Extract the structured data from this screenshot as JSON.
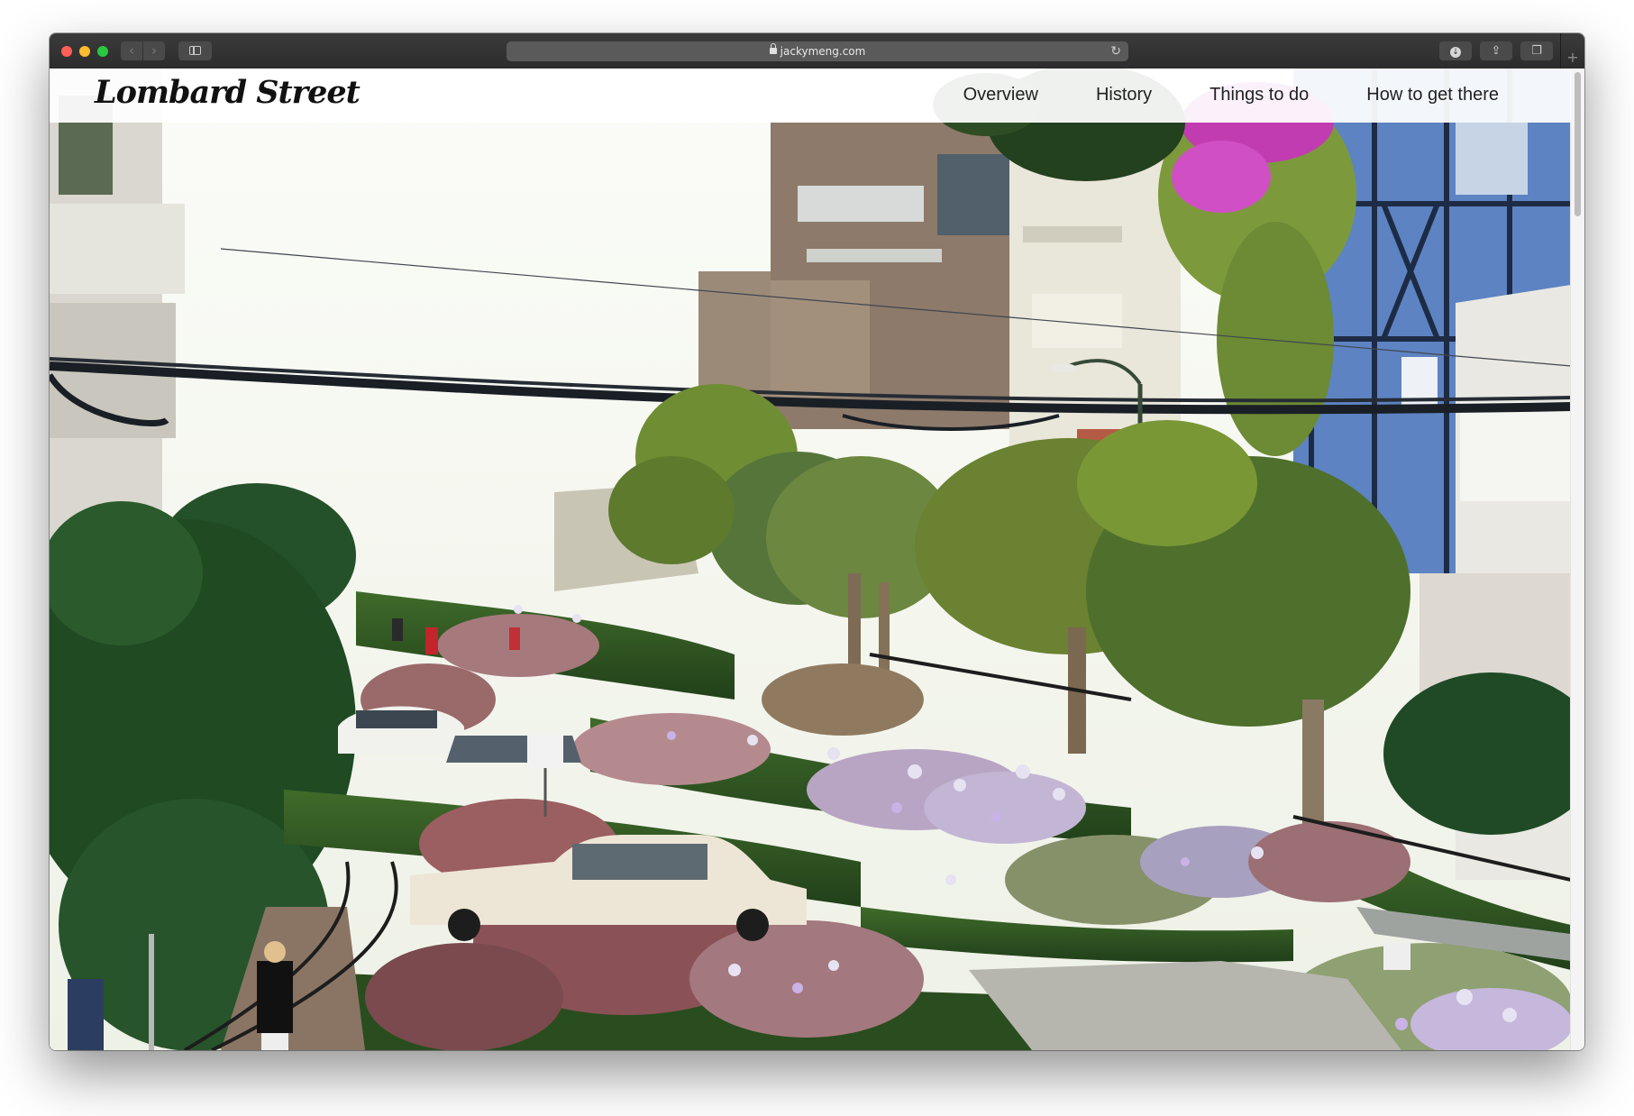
{
  "browser": {
    "url": "jackymeng.com",
    "icons": {
      "back": "chevron-left-icon",
      "forward": "chevron-right-icon",
      "sidebar": "sidebar-icon",
      "secure": "lock-icon",
      "reload": "reload-icon",
      "downloads": "download-icon",
      "share": "share-icon",
      "tabs": "tab-overview-icon",
      "new_tab": "plus-icon"
    },
    "traffic_lights": [
      "#fe5f57",
      "#febc2e",
      "#28c840"
    ]
  },
  "site": {
    "logo": "Lombard Street",
    "nav": [
      {
        "label": "Overview"
      },
      {
        "label": "History"
      },
      {
        "label": "Things to do"
      },
      {
        "label": "How to get there"
      }
    ]
  },
  "hero": {
    "image": "photo-of-lombard-street-with-flower-gardens"
  }
}
